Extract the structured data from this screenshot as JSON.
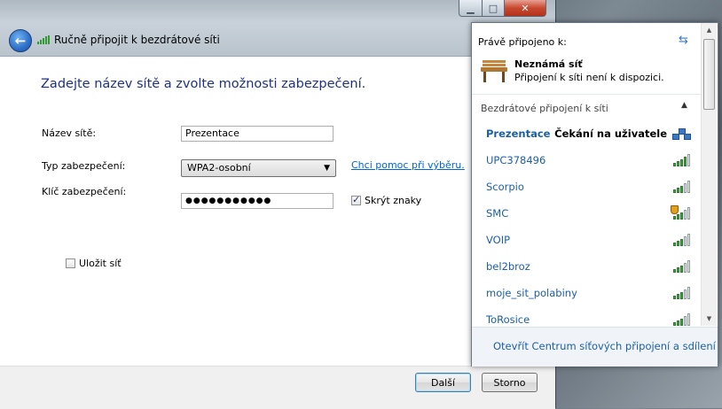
{
  "wizard": {
    "title": "Ručně připojit k bezdrátové síti",
    "heading": "Zadejte název sítě a zvolte možnosti zabezpečení.",
    "network_name_label": "Název sítě:",
    "network_name_value": "Prezentace",
    "security_type_label": "Typ zabezpečení:",
    "security_type_value": "WPA2-osobní",
    "help_link": "Chci pomoc při výběru.",
    "security_key_label": "Klíč zabezpečení:",
    "security_key_value": "●●●●●●●●●●●",
    "hide_chars_label": "Skrýt znaky",
    "hide_chars_checked": true,
    "save_network_label": "Uložit síť",
    "save_network_checked": false,
    "next_button": "Další",
    "cancel_button": "Storno"
  },
  "flyout": {
    "currently_connected_label": "Právě připojeno k:",
    "connected_network_name": "Neznámá síť",
    "connected_network_status": "Připojení k síti není k dispozici.",
    "wireless_section_label": "Bezdrátové připojení k síti",
    "networks": [
      {
        "name": "Prezentace",
        "status": "Čekání na uživatele",
        "signal": 0,
        "secured": false
      },
      {
        "name": "UPC378496",
        "status": "",
        "signal": 4,
        "secured": false
      },
      {
        "name": "Scorpio",
        "status": "",
        "signal": 3,
        "secured": false
      },
      {
        "name": "SMC",
        "status": "",
        "signal": 3,
        "secured": true
      },
      {
        "name": "VOIP",
        "status": "",
        "signal": 3,
        "secured": false
      },
      {
        "name": "bel2broz",
        "status": "",
        "signal": 3,
        "secured": false
      },
      {
        "name": "moje_sit_polabiny",
        "status": "",
        "signal": 3,
        "secured": false
      },
      {
        "name": "ToRosice",
        "status": "",
        "signal": 3,
        "secured": false
      }
    ],
    "footer_link": "Otevřít Centrum síťových připojení a sdílení"
  },
  "colors": {
    "accent_blue": "#1a5fa8",
    "heading_blue": "#1e3287",
    "signal_green": "#3aa53a"
  }
}
